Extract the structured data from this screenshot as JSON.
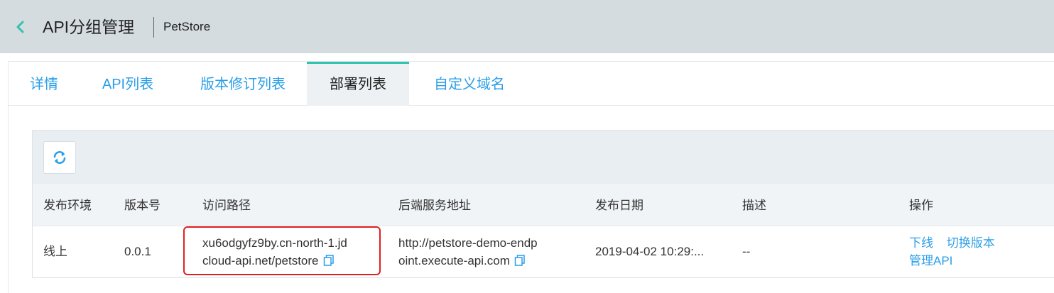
{
  "header": {
    "title": "API分组管理",
    "group_name": "PetStore"
  },
  "tabs": [
    {
      "label": "详情",
      "active": false
    },
    {
      "label": "API列表",
      "active": false
    },
    {
      "label": "版本修订列表",
      "active": false
    },
    {
      "label": "部署列表",
      "active": true
    },
    {
      "label": "自定义域名",
      "active": false
    }
  ],
  "toolbar": {
    "refresh_icon": "refresh-icon"
  },
  "table": {
    "columns": [
      "发布环境",
      "版本号",
      "访问路径",
      "后端服务地址",
      "发布日期",
      "描述",
      "操作"
    ],
    "rows": [
      {
        "environment": "线上",
        "version": "0.0.1",
        "access_path_line1": "xu6odgyfz9by.cn-north-1.jd",
        "access_path_line2": "cloud-api.net/petstore",
        "backend_line1": "http://petstore-demo-endp",
        "backend_line2": "oint.execute-api.com",
        "publish_date": "2019-04-02 10:29:...",
        "description": "--",
        "actions": {
          "offline": "下线",
          "switch_version": "切换版本",
          "manage_api": "管理API"
        }
      }
    ]
  },
  "colors": {
    "accent": "#2a9ee8",
    "active_tab_border": "#34c2b0",
    "highlight": "#e02020"
  }
}
